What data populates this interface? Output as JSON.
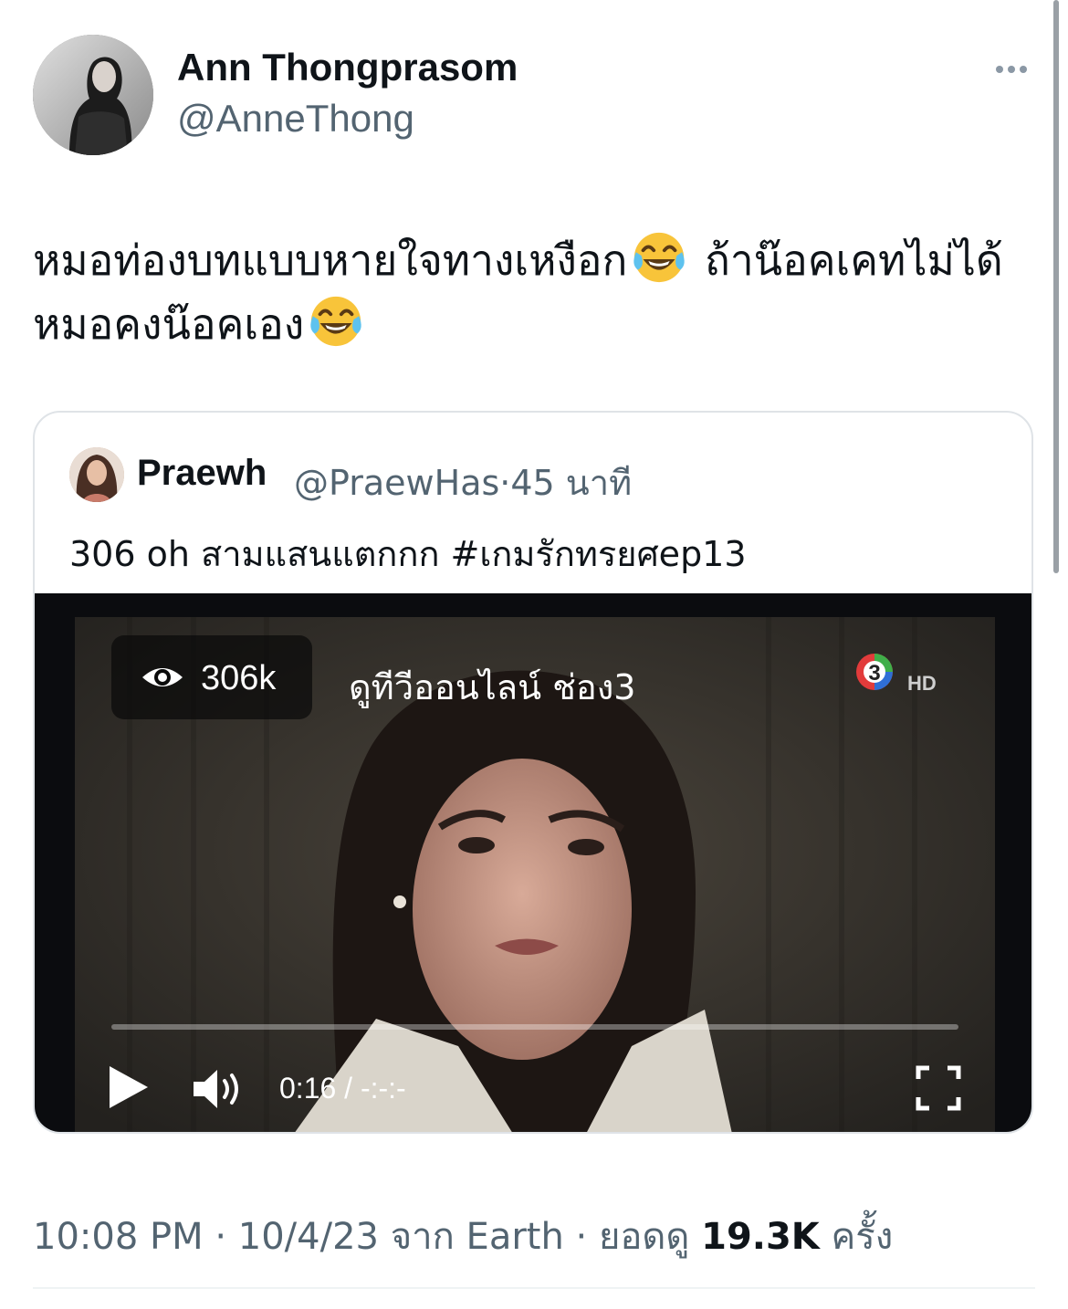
{
  "tweet": {
    "display_name": "Ann Thongprasom",
    "handle": "@AnneThong",
    "text_part1": "หมอท่องบทแบบหายใจทางเหงือก",
    "text_part2": " ถ้าน๊อคเคทไม่ได้ หมอคงน๊อคเอง",
    "emoji_icon": "face-with-tears-of-joy-icon"
  },
  "quote": {
    "display_name": "Praewh",
    "handle": "@PraewHas",
    "separator": "·",
    "time_ago": "45 นาที",
    "text": "306 oh สามแสนแตกกก #เกมรักทรยศep13"
  },
  "video": {
    "views": "306k",
    "source": "ดูทีวีออนไลน์ ช่อง3",
    "channel_logo": "3",
    "channel_badge": "HD",
    "time": "0:16 / -:-:-",
    "progress_fraction": 0.0
  },
  "footer": {
    "time": "10:08 PM",
    "sep1": "·",
    "date": "10/4/23",
    "from_label": "จาก",
    "source": "Earth",
    "sep2": "·",
    "views_label": "ยอดดู",
    "views_count": "19.3K",
    "views_unit": "ครั้ง"
  },
  "colors": {
    "primary_text": "#0f1419",
    "secondary_text": "#536471",
    "border": "#dfe3e7"
  }
}
